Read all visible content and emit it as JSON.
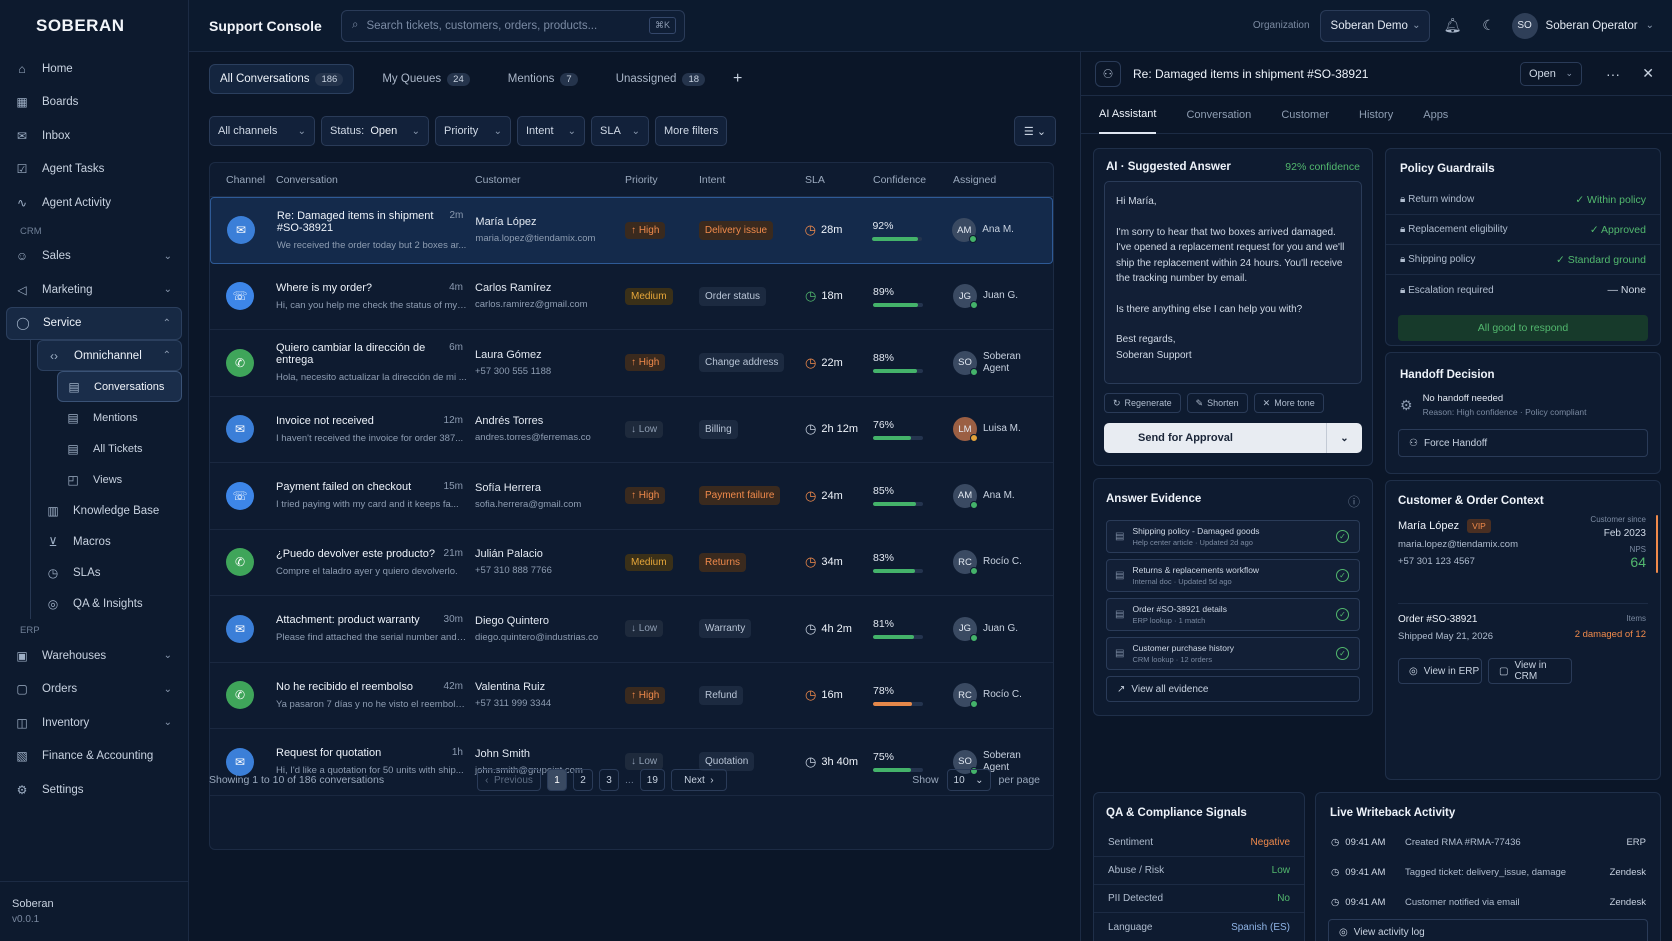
{
  "app": {
    "logo": "SOBERAN",
    "title": "Support Console"
  },
  "search": {
    "placeholder": "Search tickets, customers, orders, products...",
    "shortcut": "⌘K"
  },
  "org": {
    "label": "Organization",
    "value": "Soberan Demo"
  },
  "user": {
    "initials": "SO",
    "name": "Soberan Operator"
  },
  "sidebar": {
    "home": "Home",
    "boards": "Boards",
    "inbox": "Inbox",
    "agent_tasks": "Agent Tasks",
    "agent_activity": "Agent Activity",
    "crm": "CRM",
    "sales": "Sales",
    "marketing": "Marketing",
    "service": "Service",
    "omnichannel": "Omnichannel",
    "conversations": "Conversations",
    "mentions": "Mentions",
    "all_tickets": "All Tickets",
    "views": "Views",
    "knowledge_base": "Knowledge Base",
    "macros": "Macros",
    "slas": "SLAs",
    "qa": "QA & Insights",
    "erp": "ERP",
    "warehouses": "Warehouses",
    "orders": "Orders",
    "inventory": "Inventory",
    "finance": "Finance & Accounting",
    "settings": "Settings",
    "footer_name": "Soberan",
    "footer_version": "v0.0.1"
  },
  "tabs": [
    {
      "label": "All Conversations",
      "count": "186"
    },
    {
      "label": "My Queues",
      "count": "24"
    },
    {
      "label": "Mentions",
      "count": "7"
    },
    {
      "label": "Unassigned",
      "count": "18"
    }
  ],
  "filters": {
    "channels": "All channels",
    "status_label": "Status:",
    "status_value": "Open",
    "priority": "Priority",
    "intent": "Intent",
    "sla": "SLA",
    "more": "More filters"
  },
  "columns": {
    "channel": "Channel",
    "conversation": "Conversation",
    "customer": "Customer",
    "priority": "Priority",
    "intent": "Intent",
    "sla": "SLA",
    "confidence": "Confidence",
    "assigned": "Assigned"
  },
  "rows": [
    {
      "title": "Re: Damaged items in shipment #SO-38921",
      "time": "2m",
      "preview": "We received the order today but 2 boxes ar...",
      "customer": "María López",
      "contact": "maria.lopez@tiendamix.com",
      "priority": "↑ High",
      "intent": "Delivery issue",
      "sla": "28m",
      "confidence": "92%",
      "assignee_initials": "AM",
      "assignee": "Ana M."
    },
    {
      "title": "Where is my order?",
      "time": "4m",
      "preview": "Hi, can you help me check the status of my ...",
      "customer": "Carlos Ramírez",
      "contact": "carlos.ramirez@gmail.com",
      "priority": "Medium",
      "intent": "Order status",
      "sla": "18m",
      "confidence": "89%",
      "assignee_initials": "JG",
      "assignee": "Juan G."
    },
    {
      "title": "Quiero cambiar la dirección de entrega",
      "time": "6m",
      "preview": "Hola, necesito actualizar la dirección de mi ...",
      "customer": "Laura Gómez",
      "contact": "+57 300 555 1188",
      "priority": "↑ High",
      "intent": "Change address",
      "sla": "22m",
      "confidence": "88%",
      "assignee_initials": "SO",
      "assignee": "Soberan Agent"
    },
    {
      "title": "Invoice not received",
      "time": "12m",
      "preview": "I haven't received the invoice for order 387...",
      "customer": "Andrés Torres",
      "contact": "andres.torres@ferremas.co",
      "priority": "↓ Low",
      "intent": "Billing",
      "sla": "2h 12m",
      "confidence": "76%",
      "assignee_initials": "LM",
      "assignee": "Luisa M."
    },
    {
      "title": "Payment failed on checkout",
      "time": "15m",
      "preview": "I tried paying with my card and it keeps fa...",
      "customer": "Sofía Herrera",
      "contact": "sofia.herrera@gmail.com",
      "priority": "↑ High",
      "intent": "Payment failure",
      "sla": "24m",
      "confidence": "85%",
      "assignee_initials": "AM",
      "assignee": "Ana M."
    },
    {
      "title": "¿Puedo devolver este producto?",
      "time": "21m",
      "preview": "Compre el taladro ayer y quiero devolverlo.",
      "customer": "Julián Palacio",
      "contact": "+57 310 888 7766",
      "priority": "Medium",
      "intent": "Returns",
      "sla": "34m",
      "confidence": "83%",
      "assignee_initials": "RC",
      "assignee": "Rocío C."
    },
    {
      "title": "Attachment: product warranty",
      "time": "30m",
      "preview": "Please find attached the serial number and ...",
      "customer": "Diego Quintero",
      "contact": "diego.quintero@industrias.co",
      "priority": "↓ Low",
      "intent": "Warranty",
      "sla": "4h 2m",
      "confidence": "81%",
      "assignee_initials": "JG",
      "assignee": "Juan G."
    },
    {
      "title": "No he recibido el reembolso",
      "time": "42m",
      "preview": "Ya pasaron 7 días y no he visto el reembolso.",
      "customer": "Valentina Ruiz",
      "contact": "+57 311 999 3344",
      "priority": "↑ High",
      "intent": "Refund",
      "sla": "16m",
      "confidence": "78%",
      "assignee_initials": "RC",
      "assignee": "Rocío C."
    },
    {
      "title": "Request for quotation",
      "time": "1h",
      "preview": "Hi, I'd like a quotation for 50 units with ship...",
      "customer": "John Smith",
      "contact": "john.smith@grupeint.com",
      "priority": "↓ Low",
      "intent": "Quotation",
      "sla": "3h 40m",
      "confidence": "75%",
      "assignee_initials": "SO",
      "assignee": "Soberan Agent"
    }
  ],
  "pager": {
    "summary": "Showing 1 to 10 of 186 conversations",
    "previous": "Previous",
    "p1": "1",
    "p2": "2",
    "p3": "3",
    "ellipsis": "...",
    "p19": "19",
    "next": "Next",
    "show": "Show",
    "per_page_value": "10",
    "per_page": "per page"
  },
  "panel": {
    "title": "Re: Damaged items in shipment #SO-38921",
    "status": "Open",
    "tabs": [
      "AI Assistant",
      "Conversation",
      "Customer",
      "History",
      "Apps"
    ],
    "suggested": {
      "label": "AI · Suggested Answer",
      "confidence": "92% confidence",
      "greeting": "Hi María,",
      "p1": "I'm sorry to hear that two boxes arrived damaged. I've opened a replacement request for you and we'll ship the replacement within 24 hours. You'll receive the tracking number by email.",
      "p2": "Is there anything else I can help you with?",
      "closing": "Best regards,",
      "sign": "Soberan Support",
      "regenerate": "Regenerate",
      "shorten": "Shorten",
      "more_tone": "More tone",
      "send": "Send for Approval"
    },
    "policy": {
      "title": "Policy Guardrails",
      "r1": "Return window",
      "v1": "✓ Within policy",
      "r2": "Replacement eligibility",
      "v2": "✓ Approved",
      "r3": "Shipping policy",
      "v3": "✓ Standard ground",
      "r4": "Escalation required",
      "v4": "— None",
      "all_good": "All good to respond"
    },
    "handoff": {
      "title": "Handoff Decision",
      "status": "No handoff needed",
      "reason": "Reason: High confidence · Policy compliant",
      "force": "Force Handoff"
    },
    "evidence": {
      "title": "Answer Evidence",
      "items": [
        {
          "t": "Shipping policy - Damaged goods",
          "s": "Help center article · Updated 2d ago"
        },
        {
          "t": "Returns & replacements workflow",
          "s": "Internal doc · Updated 5d ago"
        },
        {
          "t": "Order #SO-38921 details",
          "s": "ERP lookup · 1 match"
        },
        {
          "t": "Customer purchase history",
          "s": "CRM lookup · 12 orders"
        }
      ],
      "view_all": "View all evidence"
    },
    "context": {
      "title": "Customer & Order Context",
      "name": "María López",
      "badge": "VIP",
      "email": "maria.lopez@tiendamix.com",
      "phone": "+57 301 123 4567",
      "since_label": "Customer since",
      "since": "Feb 2023",
      "nps_label": "NPS",
      "nps": "64",
      "order": "Order #SO-38921",
      "shipped": "Shipped May 21, 2026",
      "items_label": "Items",
      "items": "2 damaged of 12",
      "view_erp": "View in ERP",
      "view_crm": "View in CRM"
    },
    "qa": {
      "title": "QA & Compliance Signals",
      "r1": "Sentiment",
      "v1": "Negative",
      "r2": "Abuse / Risk",
      "v2": "Low",
      "r3": "PII Detected",
      "v3": "No",
      "r4": "Language",
      "v4": "Spanish (ES)"
    },
    "activity": {
      "title": "Live Writeback Activity",
      "items": [
        {
          "time": "09:41 AM",
          "text": "Created RMA #RMA-77436",
          "src": "ERP"
        },
        {
          "time": "09:41 AM",
          "text": "Tagged ticket: delivery_issue, damage",
          "src": "Zendesk"
        },
        {
          "time": "09:41 AM",
          "text": "Customer notified via email",
          "src": "Zendesk"
        }
      ],
      "view_log": "View activity log"
    }
  }
}
